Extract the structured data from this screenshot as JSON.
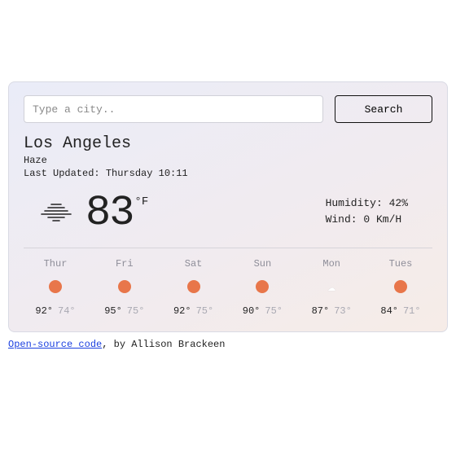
{
  "search": {
    "placeholder": "Type a city..",
    "button": "Search"
  },
  "location": {
    "city": "Los Angeles",
    "condition": "Haze",
    "last_updated": "Last Updated: Thursday 10:11"
  },
  "current": {
    "temp": "83",
    "unit": "°F",
    "humidity": "Humidity: 42%",
    "wind": "Wind: 0 Km/H"
  },
  "forecast": [
    {
      "day": "Thur",
      "icon": "sunny",
      "hi": "92°",
      "lo": "74°"
    },
    {
      "day": "Fri",
      "icon": "sunny",
      "hi": "95°",
      "lo": "75°"
    },
    {
      "day": "Sat",
      "icon": "sunny",
      "hi": "92°",
      "lo": "75°"
    },
    {
      "day": "Sun",
      "icon": "sunny",
      "hi": "90°",
      "lo": "75°"
    },
    {
      "day": "Mon",
      "icon": "cloudy",
      "hi": "87°",
      "lo": "73°"
    },
    {
      "day": "Tues",
      "icon": "sunny",
      "hi": "84°",
      "lo": "71°"
    }
  ],
  "footer": {
    "link_text": "Open-source code",
    "rest": ", by Allison Brackeen"
  }
}
